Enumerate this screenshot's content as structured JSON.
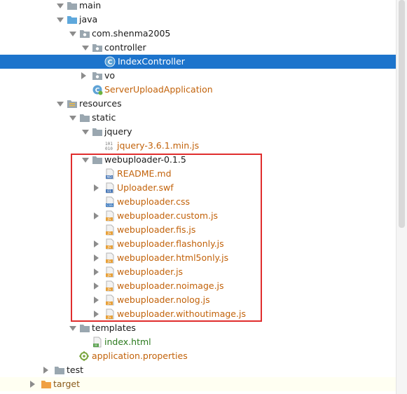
{
  "tree": {
    "rows": [
      {
        "label": "main",
        "icon": "folder-icon",
        "arrow": "down",
        "color": "normal"
      },
      {
        "label": "java",
        "icon": "source-folder-icon",
        "arrow": "down",
        "color": "normal"
      },
      {
        "label": "com.shenma2005",
        "icon": "package-icon",
        "arrow": "down",
        "color": "normal"
      },
      {
        "label": "controller",
        "icon": "folder-icon",
        "arrow": "down",
        "color": "normal"
      },
      {
        "label": "IndexController",
        "icon": "class-icon",
        "arrow": "none",
        "color": "normal",
        "selected": true
      },
      {
        "label": "vo",
        "icon": "folder-icon",
        "arrow": "right",
        "color": "normal"
      },
      {
        "label": "ServerUploadApplication",
        "icon": "spring-app-icon",
        "arrow": "none",
        "color": "orange"
      },
      {
        "label": "resources",
        "icon": "resources-folder-icon",
        "arrow": "down",
        "color": "normal"
      },
      {
        "label": "static",
        "icon": "folder-icon",
        "arrow": "down",
        "color": "normal"
      },
      {
        "label": "jquery",
        "icon": "folder-icon",
        "arrow": "down",
        "color": "normal"
      },
      {
        "label": "jquery-3.6.1.min.js",
        "icon": "binary-file-icon",
        "arrow": "none",
        "color": "orange"
      },
      {
        "label": "webuploader-0.1.5",
        "icon": "folder-icon",
        "arrow": "down",
        "color": "normal"
      },
      {
        "label": "README.md",
        "icon": "md-file-icon",
        "arrow": "none",
        "color": "orange"
      },
      {
        "label": "Uploader.swf",
        "icon": "swf-file-icon",
        "arrow": "right",
        "color": "orange"
      },
      {
        "label": "webuploader.css",
        "icon": "css-file-icon",
        "arrow": "none",
        "color": "orange"
      },
      {
        "label": "webuploader.custom.js",
        "icon": "js-file-icon",
        "arrow": "right",
        "color": "orange"
      },
      {
        "label": "webuploader.fis.js",
        "icon": "js-file-icon",
        "arrow": "none",
        "color": "orange"
      },
      {
        "label": "webuploader.flashonly.js",
        "icon": "js-file-icon",
        "arrow": "right",
        "color": "orange"
      },
      {
        "label": "webuploader.html5only.js",
        "icon": "js-file-icon",
        "arrow": "right",
        "color": "orange"
      },
      {
        "label": "webuploader.js",
        "icon": "js-file-icon",
        "arrow": "right",
        "color": "orange"
      },
      {
        "label": "webuploader.noimage.js",
        "icon": "js-file-icon",
        "arrow": "right",
        "color": "orange"
      },
      {
        "label": "webuploader.nolog.js",
        "icon": "js-file-icon",
        "arrow": "right",
        "color": "orange"
      },
      {
        "label": "webuploader.withoutimage.js",
        "icon": "js-file-icon",
        "arrow": "right",
        "color": "orange"
      },
      {
        "label": "templates",
        "icon": "folder-icon",
        "arrow": "down",
        "color": "normal"
      },
      {
        "label": "index.html",
        "icon": "html-file-icon",
        "arrow": "none",
        "color": "normal"
      },
      {
        "label": "application.properties",
        "icon": "properties-file-icon",
        "arrow": "none",
        "color": "orange"
      },
      {
        "label": "test",
        "icon": "folder-icon",
        "arrow": "right",
        "color": "normal"
      },
      {
        "label": "target",
        "icon": "excluded-folder-icon",
        "arrow": "right",
        "color": "normal",
        "faded": true
      }
    ]
  },
  "colors": {
    "selection": "#1d74cc",
    "vcs_added_text": "#c2620a",
    "highlight_border": "#e02d2d"
  }
}
